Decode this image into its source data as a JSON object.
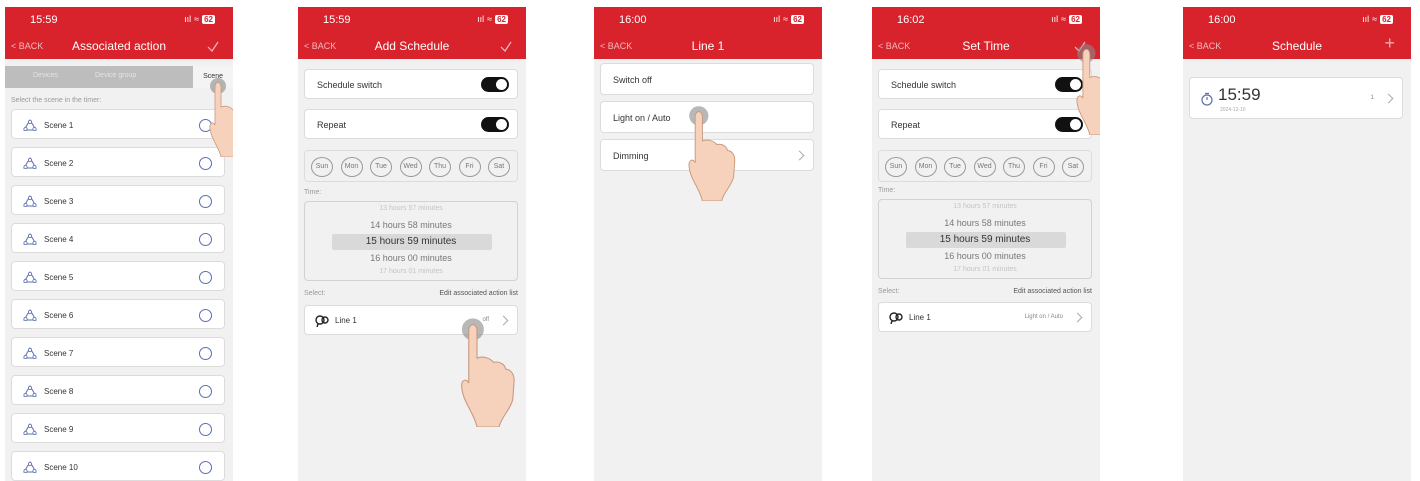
{
  "colors": {
    "brand_red": "#d8232d",
    "toggle_on": "#111111",
    "radio_blue": "#5b6fae"
  },
  "screens": [
    {
      "status": {
        "time": "15:59",
        "signal": "ııl",
        "wifi": "≈",
        "battery": "62"
      },
      "header": {
        "back": "BACK",
        "title": "Associated action",
        "action_icon": "check-icon"
      },
      "tabs": [
        "Devices",
        "Device group",
        "Scene"
      ],
      "hint": "Select the scene in the timer:",
      "scenes": [
        "Scene 1",
        "Scene 2",
        "Scene 3",
        "Scene 4",
        "Scene 5",
        "Scene 6",
        "Scene 7",
        "Scene 8",
        "Scene 9",
        "Scene 10"
      ]
    },
    {
      "status": {
        "time": "15:59",
        "signal": "ııl",
        "wifi": "≈",
        "battery": "62"
      },
      "header": {
        "back": "BACK",
        "title": "Add Schedule",
        "action_icon": "check-icon"
      },
      "schedule_switch": "Schedule switch",
      "repeat": "Repeat",
      "days": [
        "Sun",
        "Mon",
        "Tue",
        "Wed",
        "Thu",
        "Fri",
        "Sat"
      ],
      "time_label": "Time:",
      "picker": [
        "13 hours  57 minutes",
        "14 hours   58 minutes",
        "15 hours   59 minutes",
        "16 hours   00 minutes",
        "17 hours  01 minutes"
      ],
      "select_label": "Select:",
      "edit_list": "Edit associated action list",
      "line": {
        "name": "Line 1",
        "value": "off"
      }
    },
    {
      "status": {
        "time": "16:00",
        "signal": "ııl",
        "wifi": "≈",
        "battery": "62"
      },
      "header": {
        "back": "BACK",
        "title": "Line 1"
      },
      "options": [
        "Switch off",
        "Light on / Auto",
        "Dimming"
      ]
    },
    {
      "status": {
        "time": "16:02",
        "signal": "ııl",
        "wifi": "≈",
        "battery": "62"
      },
      "header": {
        "back": "BACK",
        "title": "Set Time",
        "action_icon": "check-icon"
      },
      "schedule_switch": "Schedule switch",
      "repeat": "Repeat",
      "days": [
        "Sun",
        "Mon",
        "Tue",
        "Wed",
        "Thu",
        "Fri",
        "Sat"
      ],
      "time_label": "Time:",
      "picker": [
        "13 hours  57 minutes",
        "14 hours   58 minutes",
        "15 hours   59 minutes",
        "16 hours   00 minutes",
        "17 hours  01 minutes"
      ],
      "select_label": "Select:",
      "edit_list": "Edit associated action list",
      "line": {
        "name": "Line 1",
        "value": "Light on / Auto"
      }
    },
    {
      "status": {
        "time": "16:00",
        "signal": "ııl",
        "wifi": "≈",
        "battery": "62"
      },
      "header": {
        "back": "BACK",
        "title": "Schedule",
        "action_icon": "plus-icon"
      },
      "entry": {
        "time": "15:59",
        "date": "2024-12-10",
        "count": "1"
      }
    }
  ]
}
